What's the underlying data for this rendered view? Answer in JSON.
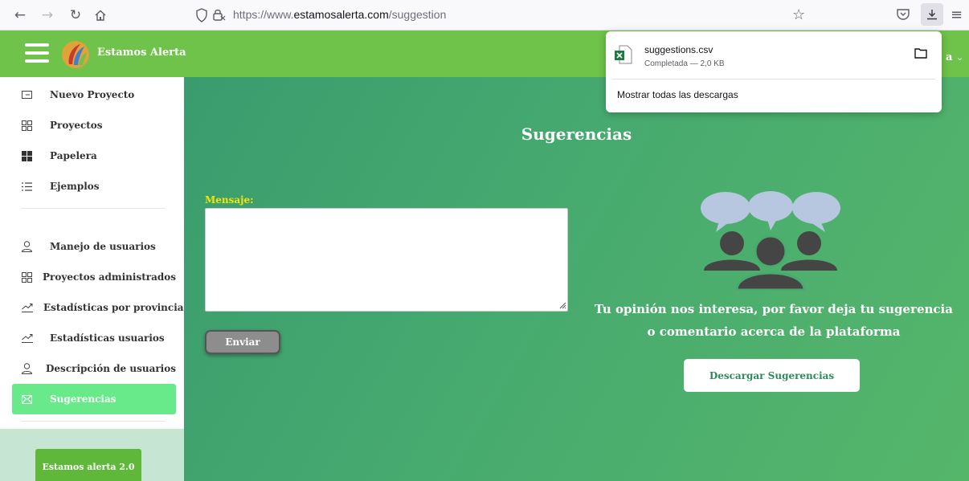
{
  "browser": {
    "url_prefix": "https://www.",
    "url_host": "estamosalerta.com",
    "url_path": "/suggestion",
    "icons": {
      "back": "arrow-left-icon",
      "forward": "arrow-right-icon",
      "reload": "reload-icon",
      "home": "home-icon",
      "shield": "shield-icon",
      "lock": "lock-icon",
      "bookmark": "star-icon",
      "pocket": "pocket-icon",
      "downloads": "download-icon",
      "menu": "menu-icon"
    }
  },
  "header": {
    "app_title": "Estamos Alerta",
    "user_partial": "a",
    "colors": {
      "header_bg": "#6fc24a"
    }
  },
  "sidebar": {
    "items": [
      {
        "label": "Nuevo Proyecto",
        "icon": "new-project-icon"
      },
      {
        "label": "Proyectos",
        "icon": "grid-icon"
      },
      {
        "label": "Papelera",
        "icon": "trash-grid-icon"
      },
      {
        "label": "Ejemplos",
        "icon": "list-icon"
      },
      {
        "label": "Manejo de usuarios",
        "icon": "user-icon"
      },
      {
        "label": "Proyectos administrados",
        "icon": "grid-icon"
      },
      {
        "label": "Estadísticas por provincia",
        "icon": "trend-icon"
      },
      {
        "label": "Estadísticas usuarios",
        "icon": "trend-icon"
      },
      {
        "label": "Descripción de usuarios",
        "icon": "user-icon"
      },
      {
        "label": "Sugerencias",
        "icon": "mail-icon",
        "active": true
      }
    ],
    "footer_button": "Estamos alerta 2.0",
    "colors": {
      "active_bg": "#68ea8a"
    }
  },
  "main": {
    "title": "Sugerencias",
    "message_label": "Mensaje:",
    "message_value": "",
    "send_button": "Enviar",
    "tagline_line1": "Tu opinión nos interesa, por favor deja tu sugerencia",
    "tagline_line2": "o comentario acerca de la plataforma",
    "download_button": "Descargar Sugerencias",
    "colors": {
      "label": "#f4e50b",
      "gradient_start": "#3a9c6e",
      "gradient_end": "#55b66a"
    }
  },
  "downloads_panel": {
    "filename": "suggestions.csv",
    "status": "Completada — 2,0 KB",
    "show_all": "Mostrar todas las descargas"
  }
}
